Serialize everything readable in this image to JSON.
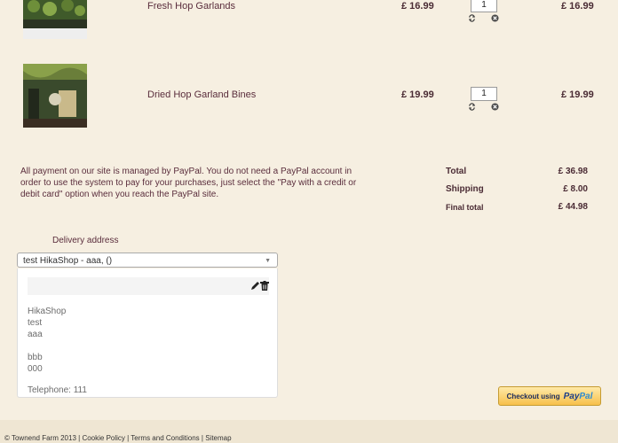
{
  "cart": {
    "items": [
      {
        "name": "Fresh Hop Garlands",
        "unit_price": "£ 16.99",
        "quantity": "1",
        "line_total": "£ 16.99"
      },
      {
        "name": "Dried Hop Garland Bines",
        "unit_price": "£ 19.99",
        "quantity": "1",
        "line_total": "£ 19.99"
      }
    ]
  },
  "payment_note": "All payment on our site is managed by PayPal. You do not need a PayPal account in order to use the system to pay for your purchases, just select the \"Pay with a credit or debit card\" option when you reach the PayPal site.",
  "totals": {
    "total_label": "Total",
    "total_value": "£ 36.98",
    "shipping_label": "Shipping",
    "shipping_value": "£ 8.00",
    "final_label": "Final total",
    "final_value": "£ 44.98"
  },
  "delivery": {
    "heading": "Delivery address",
    "selected": "test HikaShop - aaa, ()",
    "address_lines": [
      "HikaShop",
      "test",
      "aaa",
      "",
      "bbb",
      "000"
    ],
    "telephone": "Telephone: 111"
  },
  "checkout": {
    "prefix": "Checkout using",
    "brand_pay": "Pay",
    "brand_pal": "Pal"
  },
  "footer": {
    "copyright": "© Townend Farm 2013",
    "links": [
      "Cookie Policy",
      "Terms and Conditions",
      "Sitemap"
    ]
  },
  "icons": {
    "refresh": "refresh-icon",
    "remove": "remove-icon",
    "edit": "pencil-icon",
    "delete": "trash-icon",
    "dropdown": "chevron-down-icon"
  }
}
